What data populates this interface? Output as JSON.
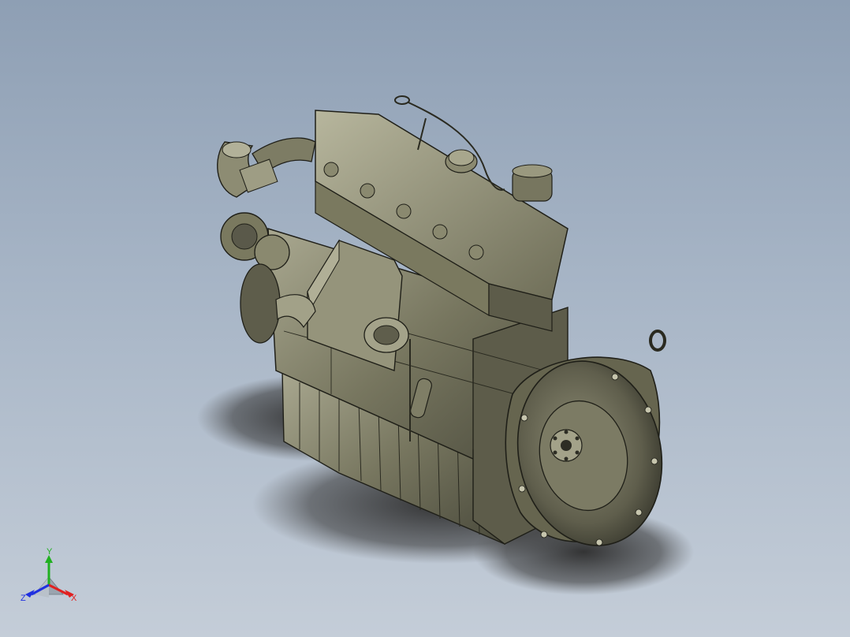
{
  "viewport": {
    "background_top": "#8e9fb4",
    "background_bottom": "#c4cdd8"
  },
  "model": {
    "icon": "engine-3d-model",
    "shade_color": "#6b6a57",
    "highlight_color": "#a7a68e",
    "edge_color": "#1f1f18"
  },
  "triad": {
    "x_label": "X",
    "y_label": "Y",
    "z_label": "Z",
    "x_color": "#e02020",
    "y_color": "#20b020",
    "z_color": "#2030e0"
  }
}
